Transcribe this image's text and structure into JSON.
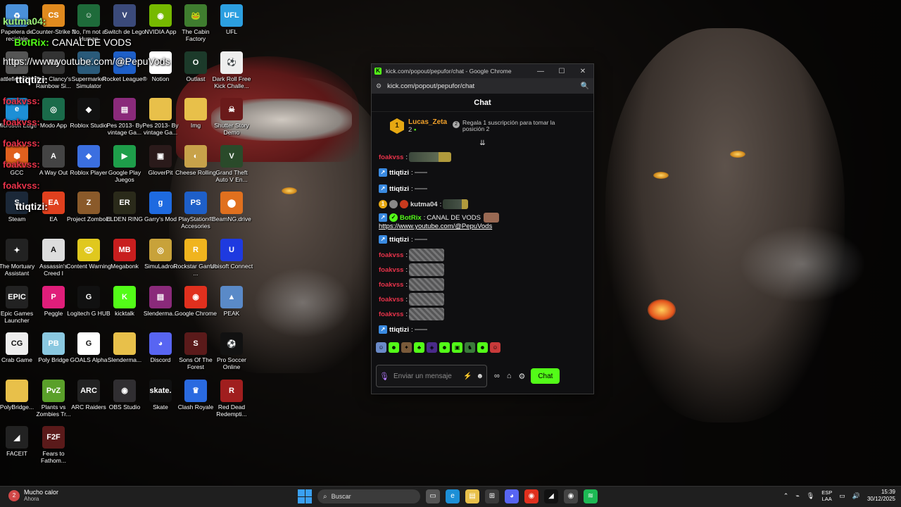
{
  "desktop_icons": [
    {
      "label": "Papelera de reciclaje",
      "icon": "recycle-bin-icon",
      "color": "#4a90d9",
      "glyph": "♻"
    },
    {
      "label": "Counter-Strike 2",
      "icon": "counter-strike-icon",
      "color": "#e08a1e",
      "glyph": "CS"
    },
    {
      "label": "No, I'm not a Human",
      "icon": "game-icon",
      "color": "#1e6b3a",
      "glyph": "☺"
    },
    {
      "label": "Switch de Lego",
      "icon": "game-icon",
      "color": "#3b4a7a",
      "glyph": "V"
    },
    {
      "label": "NVIDIA App",
      "icon": "nvidia-icon",
      "color": "#76b900",
      "glyph": "◉"
    },
    {
      "label": "The Cabin Factory",
      "icon": "cabin-factory-icon",
      "color": "#3f7d2f",
      "glyph": "🐸"
    },
    {
      "label": "UFL",
      "icon": "ufl-icon",
      "color": "#2c9fe0",
      "glyph": "UFL"
    },
    {
      "label": "Battlefield 2042",
      "icon": "game-icon",
      "color": "#555",
      "glyph": "BF"
    },
    {
      "label": "Tom Clancy's Rainbow Si...",
      "icon": "rainbow-six-icon",
      "color": "#333",
      "glyph": "R6"
    },
    {
      "label": "Supermarket Simulator",
      "icon": "supermarket-icon",
      "color": "#2a5a7a",
      "glyph": "🛒"
    },
    {
      "label": "Rocket League®",
      "icon": "rocket-league-icon",
      "color": "#1e5fc8",
      "glyph": "RL"
    },
    {
      "label": "Notion",
      "icon": "notion-icon",
      "color": "#ffffff",
      "glyph": "N"
    },
    {
      "label": "Outlast",
      "icon": "outlast-icon",
      "color": "#1c3a2a",
      "glyph": "O"
    },
    {
      "label": "Dark Roll Free Kick Challe...",
      "icon": "ball-icon",
      "color": "#eeeeee",
      "glyph": "⚽"
    },
    {
      "label": "Microsoft Edge",
      "icon": "edge-icon",
      "color": "#1d8fd6",
      "glyph": "e"
    },
    {
      "label": "Modo App",
      "icon": "app-icon",
      "color": "#1a6b4a",
      "glyph": "◎"
    },
    {
      "label": "Roblox Studio",
      "icon": "roblox-studio-icon",
      "color": "#111111",
      "glyph": "◆"
    },
    {
      "label": "Pes 2013- By vintage Ga...",
      "icon": "winrar-icon",
      "color": "#8a2a7a",
      "glyph": "▤"
    },
    {
      "label": "Pes 2013- By vintage Ga...",
      "icon": "folder-icon",
      "color": "#e8c04a",
      "glyph": ""
    },
    {
      "label": "Img",
      "icon": "folder-icon",
      "color": "#e8c04a",
      "glyph": ""
    },
    {
      "label": "Shutter Story Demo",
      "icon": "game-icon",
      "color": "#6a1a1a",
      "glyph": "☠"
    },
    {
      "label": "GCC",
      "icon": "gcc-icon",
      "color": "#e0601e",
      "glyph": "⬢"
    },
    {
      "label": "A Way Out",
      "icon": "game-icon",
      "color": "#444",
      "glyph": "A"
    },
    {
      "label": "Roblox Player",
      "icon": "roblox-icon",
      "color": "#3b6fe0",
      "glyph": "◆"
    },
    {
      "label": "Google Play Juegos",
      "icon": "play-games-icon",
      "color": "#1e9e4a",
      "glyph": "▶"
    },
    {
      "label": "GloverPit",
      "icon": "game-icon",
      "color": "#2a1a1a",
      "glyph": "▣"
    },
    {
      "label": "Cheese Rolling",
      "icon": "game-icon",
      "color": "#c8a24a",
      "glyph": "◐"
    },
    {
      "label": "Grand Theft Auto V En...",
      "icon": "gta-icon",
      "color": "#2a4a2a",
      "glyph": "V"
    },
    {
      "label": "Steam",
      "icon": "steam-icon",
      "color": "#1b2838",
      "glyph": "S"
    },
    {
      "label": "EA",
      "icon": "ea-icon",
      "color": "#e0401e",
      "glyph": "EA"
    },
    {
      "label": "Project Zomboid",
      "icon": "game-icon",
      "color": "#8a5a2a",
      "glyph": "Z"
    },
    {
      "label": "ELDEN RING",
      "icon": "elden-ring-icon",
      "color": "#2a2a1a",
      "glyph": "ER"
    },
    {
      "label": "Garry's Mod",
      "icon": "gmod-icon",
      "color": "#1e6ae0",
      "glyph": "g"
    },
    {
      "label": "PlayStation® Accesories",
      "icon": "playstation-icon",
      "color": "#1e5fc8",
      "glyph": "PS"
    },
    {
      "label": "BeamNG.drive",
      "icon": "beamng-icon",
      "color": "#e0701e",
      "glyph": "⬤"
    },
    {
      "label": "The Mortuary Assistant",
      "icon": "game-icon",
      "color": "#222",
      "glyph": "✦"
    },
    {
      "label": "Assassin's Creed I",
      "icon": "game-icon",
      "color": "#dddddd",
      "glyph": "A"
    },
    {
      "label": "Content Warning",
      "icon": "game-icon",
      "color": "#e0c81e",
      "glyph": "👁"
    },
    {
      "label": "Megabonk",
      "icon": "game-icon",
      "color": "#c81e1e",
      "glyph": "MB"
    },
    {
      "label": "SimuLadron",
      "icon": "game-icon",
      "color": "#c8a23a",
      "glyph": "◎"
    },
    {
      "label": "Rockstar Games ...",
      "icon": "rockstar-icon",
      "color": "#f0b41e",
      "glyph": "R"
    },
    {
      "label": "Ubisoft Connect",
      "icon": "ubisoft-icon",
      "color": "#1e3ae0",
      "glyph": "U"
    },
    {
      "label": "Epic Games Launcher",
      "icon": "epic-icon",
      "color": "#222222",
      "glyph": "EPIC"
    },
    {
      "label": "Peggle",
      "icon": "game-icon",
      "color": "#e01e7a",
      "glyph": "P"
    },
    {
      "label": "Logitech G HUB",
      "icon": "logitech-icon",
      "color": "#111111",
      "glyph": "G"
    },
    {
      "label": "kicktalk",
      "icon": "kick-icon",
      "color": "#53fc18",
      "glyph": "K"
    },
    {
      "label": "Slenderma...",
      "icon": "winrar-icon",
      "color": "#8a2a7a",
      "glyph": "▤"
    },
    {
      "label": "Google Chrome",
      "icon": "chrome-icon",
      "color": "#e0301e",
      "glyph": "◉"
    },
    {
      "label": "PEAK",
      "icon": "game-icon",
      "color": "#5a8ac8",
      "glyph": "▲"
    },
    {
      "label": "Crab Game",
      "icon": "game-icon",
      "color": "#eeeeee",
      "glyph": "CG"
    },
    {
      "label": "Poly Bridge",
      "icon": "game-icon",
      "color": "#8ac8e0",
      "glyph": "PB"
    },
    {
      "label": "GOALS Alpha",
      "icon": "game-icon",
      "color": "#ffffff",
      "glyph": "G"
    },
    {
      "label": "Slenderma...",
      "icon": "folder-icon",
      "color": "#e8c04a",
      "glyph": ""
    },
    {
      "label": "Discord",
      "icon": "discord-icon",
      "color": "#5865f2",
      "glyph": "◕"
    },
    {
      "label": "Sons Of The Forest",
      "icon": "game-icon",
      "color": "#5a1a1a",
      "glyph": "S"
    },
    {
      "label": "Pro Soccer Online",
      "icon": "game-icon",
      "color": "#111111",
      "glyph": "⚽"
    },
    {
      "label": "PolyBridge...",
      "icon": "folder-icon",
      "color": "#e8c04a",
      "glyph": ""
    },
    {
      "label": "Plants vs Zombies Tr...",
      "icon": "game-icon",
      "color": "#5aa02a",
      "glyph": "PvZ"
    },
    {
      "label": "ARC Raiders",
      "icon": "game-icon",
      "color": "#222222",
      "glyph": "ARC"
    },
    {
      "label": "OBS Studio",
      "icon": "obs-icon",
      "color": "#302e31",
      "glyph": "◉"
    },
    {
      "label": "Skate",
      "icon": "game-icon",
      "color": "#111111",
      "glyph": "skate."
    },
    {
      "label": "Clash Royale",
      "icon": "game-icon",
      "color": "#2a6ae0",
      "glyph": "♛"
    },
    {
      "label": "Red Dead Redempti...",
      "icon": "game-icon",
      "color": "#a01e1e",
      "glyph": "R"
    },
    {
      "label": "FACEIT",
      "icon": "faceit-icon",
      "color": "#222222",
      "glyph": "◢"
    },
    {
      "label": "Fears to Fathom...",
      "icon": "game-icon",
      "color": "#5a1a1a",
      "glyph": "F2F"
    }
  ],
  "overlay": {
    "line1_user": "kutma04:",
    "line2_user": "BotRix:",
    "line2_text": "CANAL DE VODS",
    "line3_text": "https://www.youtube.com/@PepuVods",
    "line4_user": "ttiqtizi:",
    "fo1": "foakvss:",
    "fo2": "foakvss:",
    "fo3": "foakvss:",
    "fo4": "foakvss:",
    "fo5": "foakvss:",
    "tt2": "ttiqtizi:",
    "tt0": "ttiqtizi:"
  },
  "window": {
    "title": "kick.com/popout/pepufor/chat - Google Chrome",
    "url": "kick.com/popout/pepufor/chat",
    "chat_title": "Chat",
    "pinned": {
      "rank": "1",
      "name": "Lucas_Zeta",
      "count": "2",
      "gift_text": "Regala 1 suscripción para tomar la posición 2"
    },
    "messages": [
      {
        "user": "foakvss",
        "color": "#e8334a",
        "text": ""
      },
      {
        "user": "ttiqtizi",
        "color": "#ffffff",
        "text": ""
      },
      {
        "user": "ttiqtizi",
        "color": "#ffffff",
        "text": ""
      },
      {
        "user": "kutma04",
        "color": "#dddddd",
        "text": ""
      },
      {
        "user": "BotRix",
        "color": "#53fc18",
        "text": "CANAL DE VODS"
      },
      {
        "user": "ttiqtizi",
        "color": "#ffffff",
        "text": ""
      },
      {
        "user": "foakvss",
        "color": "#e8334a",
        "text": ""
      },
      {
        "user": "foakvss",
        "color": "#e8334a",
        "text": ""
      },
      {
        "user": "foakvss",
        "color": "#e8334a",
        "text": ""
      },
      {
        "user": "foakvss",
        "color": "#e8334a",
        "text": ""
      },
      {
        "user": "foakvss",
        "color": "#e8334a",
        "text": ""
      },
      {
        "user": "ttiqtizi",
        "color": "#ffffff",
        "text": ""
      }
    ],
    "botrix_link": "https://www.youtube.com/@PepuVods",
    "input_placeholder": "Enviar un mensaje",
    "send_label": "Chat"
  },
  "taskbar": {
    "weather_title": "Mucho calor",
    "weather_sub": "Ahora",
    "weather_badge": "2",
    "search_placeholder": "Buscar",
    "lang_top": "ESP",
    "lang_bottom": "LAA",
    "time": "15:39",
    "date": "30/12/2025"
  },
  "colors": {
    "kick_green": "#53fc18",
    "chat_bg": "#0f0f11",
    "username_red": "#e8334a",
    "pinned_gold": "#f3a22a"
  }
}
